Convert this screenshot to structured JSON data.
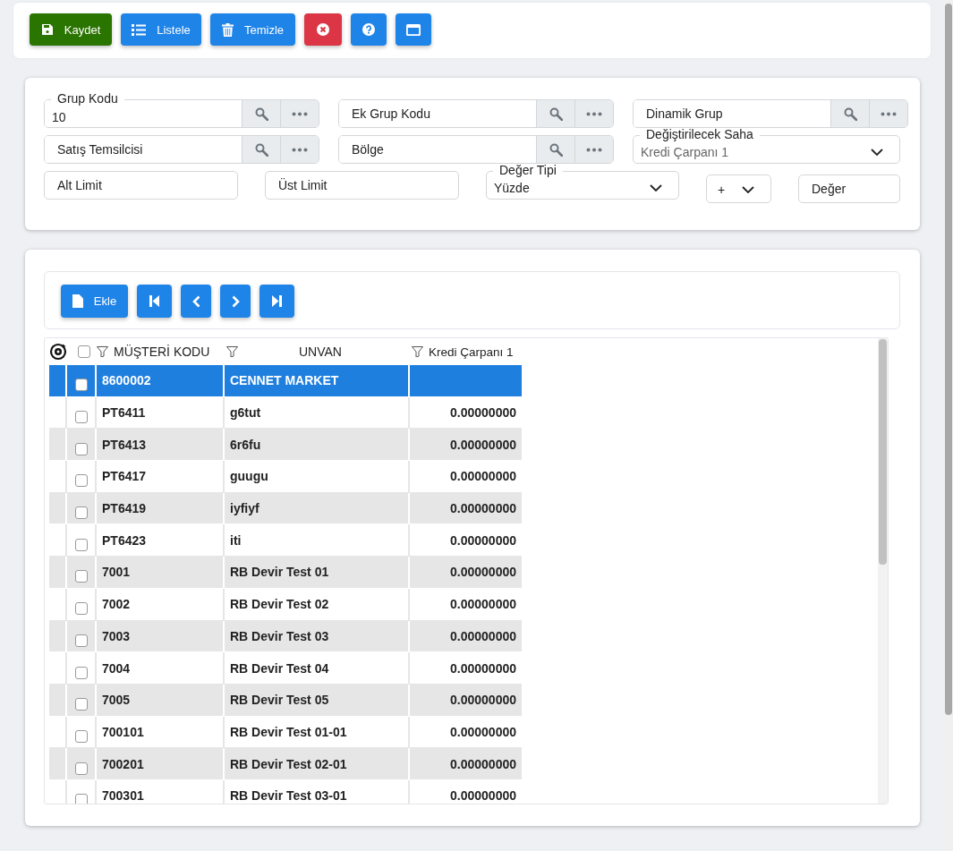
{
  "toolbar": {
    "buttons": [
      {
        "kind": "save",
        "label": "Kaydet"
      },
      {
        "kind": "list",
        "label": "Listele"
      },
      {
        "kind": "clear",
        "label": "Temizle"
      },
      {
        "kind": "cancel"
      },
      {
        "kind": "help"
      },
      {
        "kind": "window"
      }
    ]
  },
  "filters": {
    "rows": [
      [
        {
          "kind": "lookup",
          "label": "Grup Kodu",
          "value": "10"
        },
        {
          "kind": "lookup",
          "placeholder": "Ek Grup Kodu"
        },
        {
          "kind": "lookup",
          "placeholder": "Dinamik Grup"
        }
      ],
      [
        {
          "kind": "lookup",
          "placeholder": "Satış Temsilcisi"
        },
        {
          "kind": "lookup",
          "placeholder": "Bölge"
        },
        {
          "kind": "select",
          "label": "Değiştirilecek Saha",
          "value": "Kredi Çarpanı 1",
          "muted": true
        }
      ],
      [
        {
          "kind": "text",
          "placeholder": "Alt Limit"
        },
        {
          "kind": "text",
          "placeholder": "Üst Limit"
        },
        {
          "kind": "select",
          "label": "Değer Tipi",
          "value": "Yüzde",
          "muted": false
        },
        {
          "kind": "select",
          "value": "+",
          "muted": false
        },
        {
          "kind": "text",
          "placeholder": "Değer"
        }
      ]
    ]
  },
  "grid_toolbar": {
    "buttons": [
      {
        "kind": "add",
        "label": "Ekle"
      },
      {
        "kind": "first"
      },
      {
        "kind": "prev"
      },
      {
        "kind": "next"
      },
      {
        "kind": "last"
      }
    ]
  },
  "table": {
    "all_checked": false,
    "columns": [
      "MÜŞTERİ KODU",
      "UNVAN",
      "Kredi Çarpanı 1"
    ],
    "rows": [
      {
        "code": "8600002",
        "name": "CENNET MARKET",
        "value": "",
        "selected": true,
        "checked": false
      },
      {
        "code": "PT6411",
        "name": "g6tut",
        "value": "0.00000000",
        "selected": false,
        "checked": false
      },
      {
        "code": "PT6413",
        "name": "6r6fu",
        "value": "0.00000000",
        "selected": false,
        "checked": false
      },
      {
        "code": "PT6417",
        "name": "guugu",
        "value": "0.00000000",
        "selected": false,
        "checked": false
      },
      {
        "code": "PT6419",
        "name": "iyfiyf",
        "value": "0.00000000",
        "selected": false,
        "checked": false
      },
      {
        "code": "PT6423",
        "name": "iti",
        "value": "0.00000000",
        "selected": false,
        "checked": false
      },
      {
        "code": "7001",
        "name": "RB Devir Test 01",
        "value": "0.00000000",
        "selected": false,
        "checked": false
      },
      {
        "code": "7002",
        "name": "RB Devir Test 02",
        "value": "0.00000000",
        "selected": false,
        "checked": false
      },
      {
        "code": "7003",
        "name": "RB Devir Test 03",
        "value": "0.00000000",
        "selected": false,
        "checked": false
      },
      {
        "code": "7004",
        "name": "RB Devir Test 04",
        "value": "0.00000000",
        "selected": false,
        "checked": false
      },
      {
        "code": "7005",
        "name": "RB Devir Test 05",
        "value": "0.00000000",
        "selected": false,
        "checked": false
      },
      {
        "code": "700101",
        "name": "RB Devir Test 01-01",
        "value": "0.00000000",
        "selected": false,
        "checked": false
      },
      {
        "code": "700201",
        "name": "RB Devir Test 02-01",
        "value": "0.00000000",
        "selected": false,
        "checked": false
      },
      {
        "code": "700301",
        "name": "RB Devir Test 03-01",
        "value": "0.00000000",
        "selected": false,
        "checked": false
      }
    ]
  }
}
